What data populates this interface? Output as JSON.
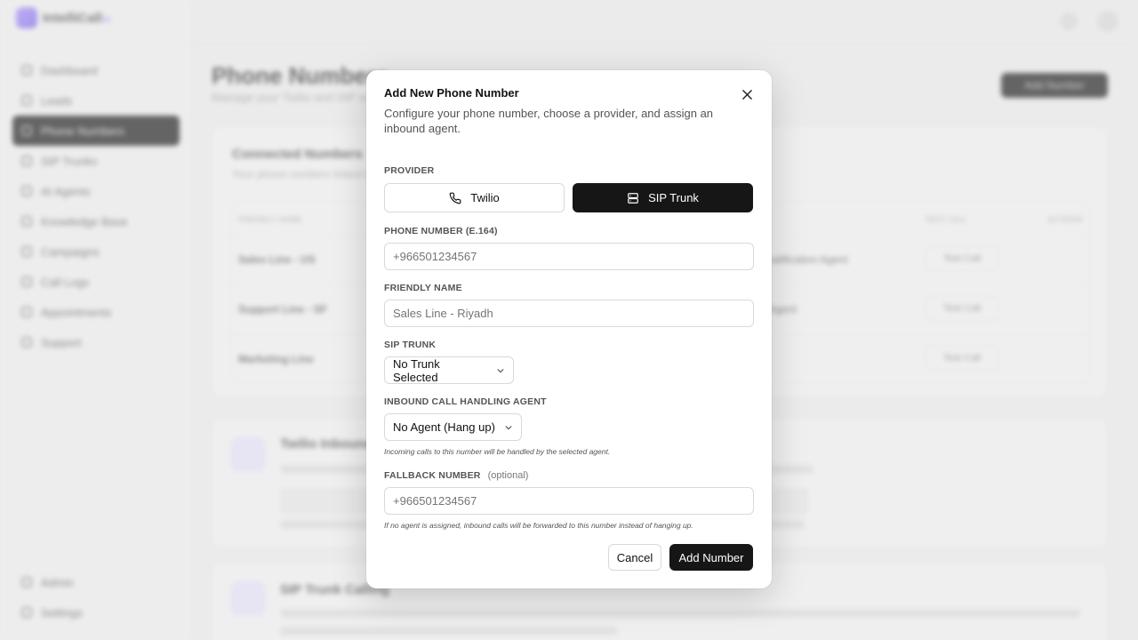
{
  "app": {
    "brand": "IntelliCall",
    "brand_suffix": "AI",
    "page_title": "Phone Numbers",
    "page_subtitle": "Manage your Twilio and SIP numbers",
    "header_button": "Add Number",
    "sidebar": {
      "items": [
        {
          "label": "Dashboard",
          "active": false
        },
        {
          "label": "Leads",
          "active": false
        },
        {
          "label": "Phone Numbers",
          "active": true
        },
        {
          "label": "SIP Trunks",
          "active": false
        },
        {
          "label": "AI Agents",
          "active": false
        },
        {
          "label": "Knowledge Base",
          "active": false
        },
        {
          "label": "Campaigns",
          "active": false
        },
        {
          "label": "Call Logs",
          "active": false
        },
        {
          "label": "Appointments",
          "active": false
        },
        {
          "label": "Support",
          "active": false
        }
      ],
      "bottom_items": [
        {
          "label": "Admin"
        },
        {
          "label": "Settings"
        }
      ]
    },
    "connected": {
      "title": "Connected Numbers",
      "subtitle": "Your phone numbers linked to agents",
      "columns": [
        "FRIENDLY NAME",
        "TEST CALL",
        "ACTIONS"
      ],
      "rows": [
        {
          "name": "Sales Line - US",
          "agent": "Sales Qualification Agent",
          "test": "Test Call"
        },
        {
          "name": "Support Line - SF",
          "agent": "Support Agent",
          "test": "Test Call"
        },
        {
          "name": "Marketing Line",
          "agent": "",
          "test": "Test Call"
        }
      ]
    },
    "twilio_card": {
      "title": "Twilio Inbound"
    },
    "sip_card": {
      "title": "SIP Trunk Calling"
    }
  },
  "modal": {
    "title": "Add New Phone Number",
    "description": "Configure your phone number, choose a provider, and assign an inbound agent.",
    "provider": {
      "label": "PROVIDER",
      "options": [
        {
          "label": "Twilio",
          "icon": "phone-icon",
          "selected": false
        },
        {
          "label": "SIP Trunk",
          "icon": "server-icon",
          "selected": true
        }
      ]
    },
    "phone_number": {
      "label": "PHONE NUMBER (E.164)",
      "placeholder": "+966501234567",
      "value": ""
    },
    "friendly_name": {
      "label": "FRIENDLY NAME",
      "placeholder": "Sales Line - Riyadh",
      "value": ""
    },
    "sip_trunk": {
      "label": "SIP TRUNK",
      "selected": "No Trunk Selected"
    },
    "inbound_agent": {
      "label": "INBOUND CALL HANDLING AGENT",
      "selected": "No Agent (Hang up)",
      "hint": "Incoming calls to this number will be handled by the selected agent."
    },
    "fallback_number": {
      "label": "FALLBACK NUMBER",
      "optional": "(optional)",
      "placeholder": "+966501234567",
      "value": "",
      "hint": "If no agent is assigned, inbound calls will be forwarded to this number instead of hanging up."
    },
    "cancel_label": "Cancel",
    "submit_label": "Add Number"
  },
  "colors": {
    "primary": "#161616",
    "brand": "#7b61e8",
    "overlay": "#e9e9ea"
  }
}
